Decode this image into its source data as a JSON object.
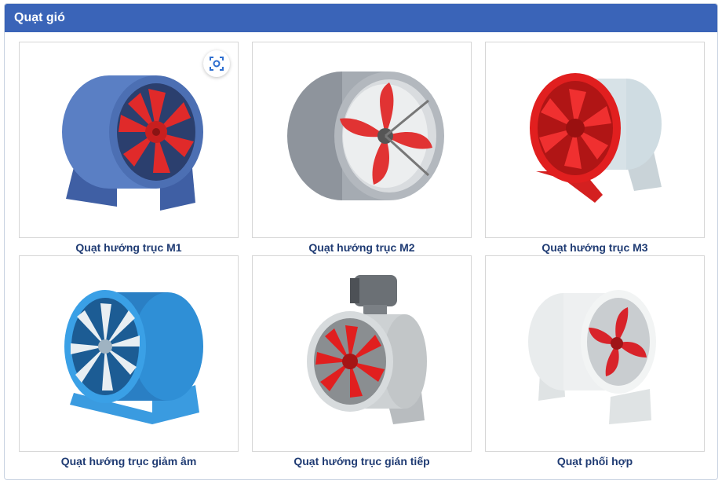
{
  "panel": {
    "title": "Quạt gió"
  },
  "products": [
    {
      "name": "Quạt hướng trục M1",
      "icon": "axial-fan-blue-icon",
      "housing": "#4f73b8",
      "blade": "#e02a2a"
    },
    {
      "name": "Quạt hướng trục M2",
      "icon": "axial-fan-silver-icon",
      "housing": "#9aa0a8",
      "blade": "#e13333"
    },
    {
      "name": "Quạt hướng trục M3",
      "icon": "axial-fan-red-icon",
      "housing": "#c8d6dc",
      "blade": "#e11f1f"
    },
    {
      "name": "Quạt hướng trục giảm âm",
      "icon": "axial-fan-lightblue-icon",
      "housing": "#2f8fd6",
      "blade": "#e8eef2"
    },
    {
      "name": "Quạt hướng trục gián tiếp",
      "icon": "belt-drive-fan-icon",
      "housing": "#d2d6d8",
      "blade": "#e11f1f"
    },
    {
      "name": "Quạt phối hợp",
      "icon": "mixed-flow-fan-icon",
      "housing": "#e6e9ea",
      "blade": "#d8232a"
    }
  ],
  "lens_icon": "visual-search-icon",
  "colors": {
    "header": "#3a64b8",
    "label": "#1f3b73"
  }
}
